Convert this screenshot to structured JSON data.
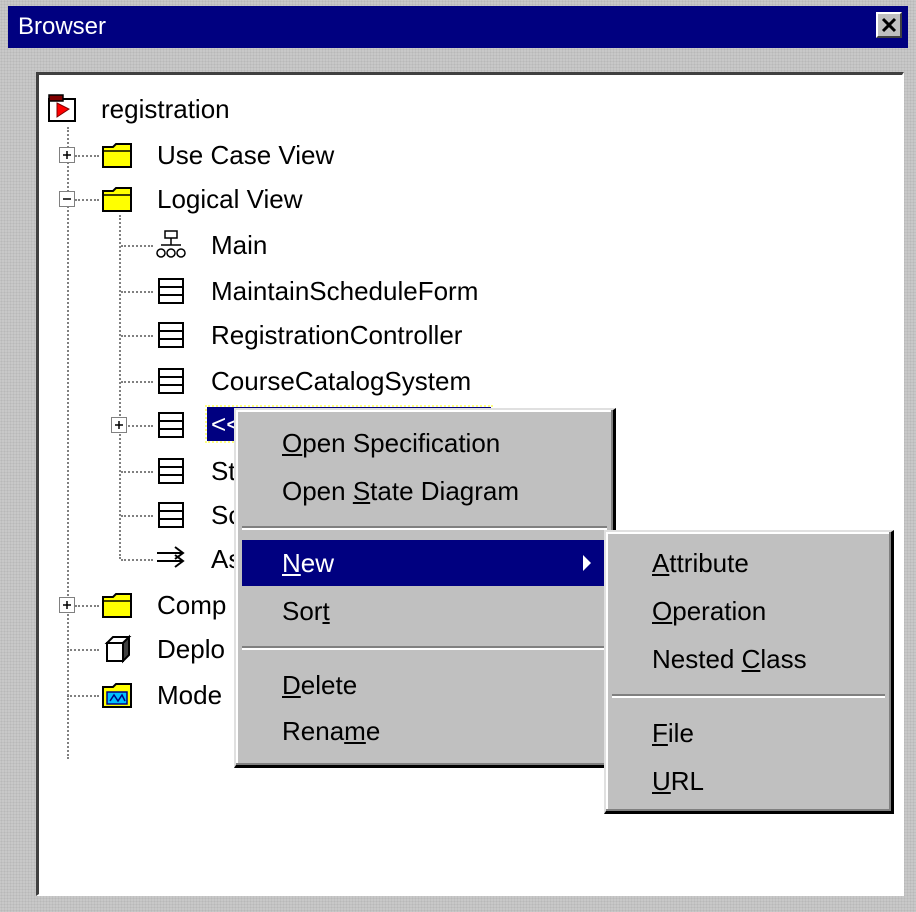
{
  "window": {
    "title": "Browser"
  },
  "tree": {
    "root_label": "registration",
    "items": [
      {
        "label": "Use Case View",
        "icon": "folder-icon"
      },
      {
        "label": "Logical View",
        "icon": "folder-icon"
      },
      {
        "label": "Main",
        "icon": "class-diagram-icon"
      },
      {
        "label": "MaintainScheduleForm",
        "icon": "class-icon"
      },
      {
        "label": "RegistrationController",
        "icon": "class-icon"
      },
      {
        "label": "CourseCatalogSystem",
        "icon": "class-icon"
      },
      {
        "label": "<<",
        "icon": "class-icon"
      },
      {
        "label": "St",
        "icon": "class-icon"
      },
      {
        "label": "Sc",
        "icon": "class-icon"
      },
      {
        "label": "As",
        "icon": "association-icon"
      },
      {
        "label": "Comp",
        "icon": "folder-icon"
      },
      {
        "label": "Deplo",
        "icon": "deployment-icon"
      },
      {
        "label": "Mode",
        "icon": "model-properties-icon"
      }
    ]
  },
  "context_menu": {
    "items": [
      {
        "pre": "",
        "u": "O",
        "post": "pen Specification"
      },
      {
        "pre": "Open ",
        "u": "S",
        "post": "tate Diagram"
      },
      {
        "pre": "",
        "u": "N",
        "post": "ew"
      },
      {
        "pre": "Sor",
        "u": "t",
        "post": ""
      },
      {
        "pre": "",
        "u": "D",
        "post": "elete"
      },
      {
        "pre": "Rena",
        "u": "m",
        "post": "e"
      }
    ]
  },
  "submenu": {
    "items": [
      {
        "pre": "",
        "u": "A",
        "post": "ttribute"
      },
      {
        "pre": "",
        "u": "O",
        "post": "peration"
      },
      {
        "pre": "Nested ",
        "u": "C",
        "post": "lass"
      },
      {
        "pre": "",
        "u": "F",
        "post": "ile"
      },
      {
        "pre": "",
        "u": "U",
        "post": "RL"
      }
    ]
  },
  "colors": {
    "titlebar": "#000080",
    "highlight": "#000080",
    "menu_bg": "#c0c0c0",
    "folder": "#ffff00"
  }
}
